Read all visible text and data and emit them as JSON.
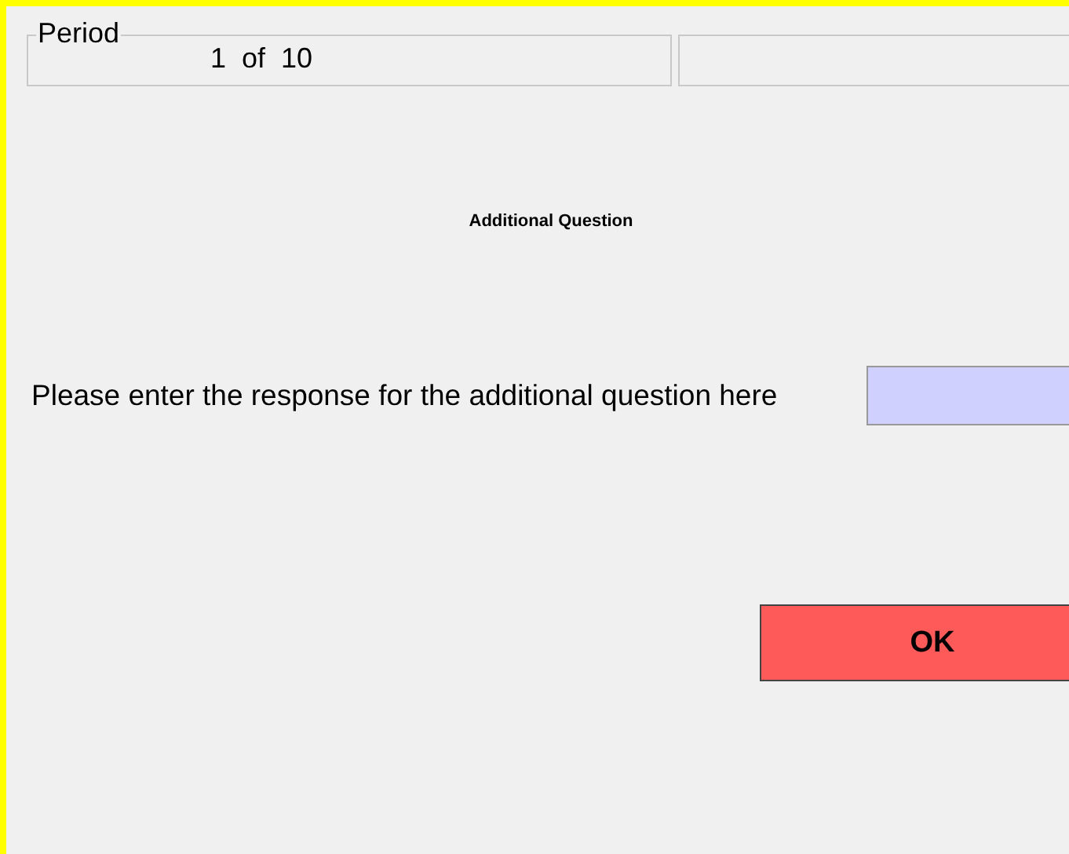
{
  "period": {
    "label": "Period",
    "value": "1  of  10"
  },
  "title": "Additional Question",
  "prompt": "Please enter the response for the additional question here",
  "ok_button": {
    "label": "OK"
  }
}
